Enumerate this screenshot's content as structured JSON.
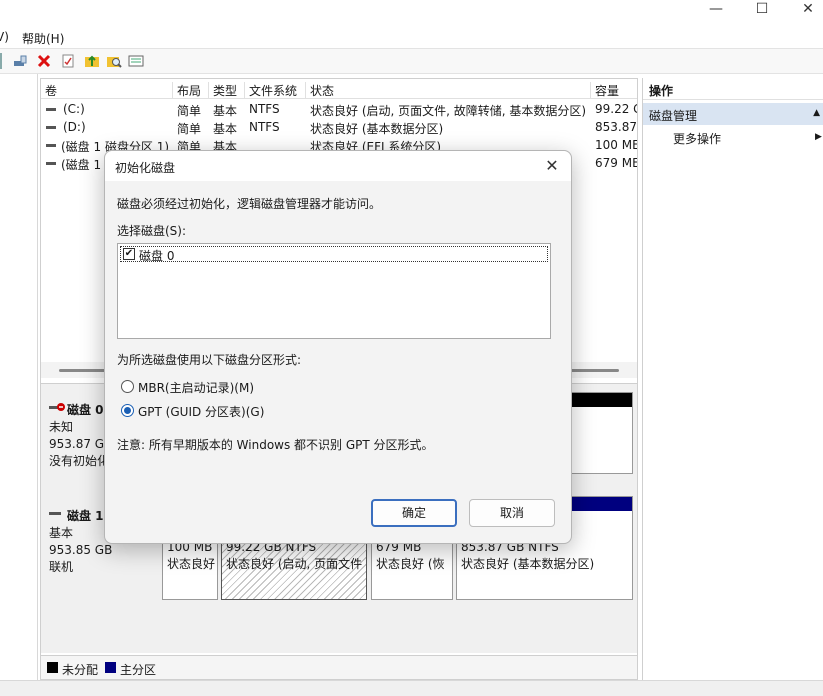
{
  "window": {
    "minimize": "—",
    "maximize": "☐",
    "close": "✕"
  },
  "menu": {
    "partial_item": "Ⅴ)",
    "help": "帮助(H)"
  },
  "volume_table": {
    "columns": [
      "卷",
      "布局",
      "类型",
      "文件系统",
      "状态",
      "容量"
    ],
    "rows": [
      {
        "name": "(C:)",
        "layout": "简单",
        "type": "基本",
        "fs": "NTFS",
        "status": "状态良好 (启动, 页面文件, 故障转储, 基本数据分区)",
        "capacity": "99.22 G"
      },
      {
        "name": "(D:)",
        "layout": "简单",
        "type": "基本",
        "fs": "NTFS",
        "status": "状态良好 (基本数据分区)",
        "capacity": "853.87"
      },
      {
        "name": "(磁盘 1 磁盘分区 1)",
        "layout": "简单",
        "type": "基本",
        "fs": "",
        "status": "状态良好 (EFI 系统分区)",
        "capacity": "100 ME"
      },
      {
        "name": "(磁盘 1",
        "layout": "",
        "type": "",
        "fs": "",
        "status": "",
        "capacity": "679 ME"
      }
    ]
  },
  "disk0": {
    "title": "磁盘 0",
    "type": "未知",
    "size": "953.87 GE",
    "state": "没有初始化"
  },
  "disk1": {
    "title": "磁盘 1",
    "type": "基本",
    "size": "953.85 GB",
    "state": "联机",
    "partitions": [
      {
        "size": "100 MB",
        "status": "状态良好"
      },
      {
        "size": "99.22 GB NTFS",
        "status": "状态良好 (启动, 页面文件"
      },
      {
        "size": "679 MB",
        "status": "状态良好 (恢"
      },
      {
        "size": "853.87 GB NTFS",
        "status": "状态良好 (基本数据分区)"
      }
    ]
  },
  "legend": {
    "unallocated": "未分配",
    "primary": "主分区"
  },
  "actions": {
    "title": "操作",
    "selected": "磁盘管理",
    "more": "更多操作"
  },
  "dialog": {
    "title": "初始化磁盘",
    "intro": "磁盘必须经过初始化，逻辑磁盘管理器才能访问。",
    "select_label": "选择磁盘(S):",
    "disk_item": "磁盘 0",
    "partition_style_label": "为所选磁盘使用以下磁盘分区形式:",
    "mbr_option": "MBR(主启动记录)(M)",
    "gpt_option": "GPT (GUID 分区表)(G)",
    "note": "注意: 所有早期版本的 Windows 都不识别 GPT 分区形式。",
    "ok": "确定",
    "cancel": "取消",
    "selected_style": "GPT"
  },
  "colors": {
    "unallocated": "#000000",
    "primary": "#00007f",
    "accent": "#1a5fb4"
  }
}
